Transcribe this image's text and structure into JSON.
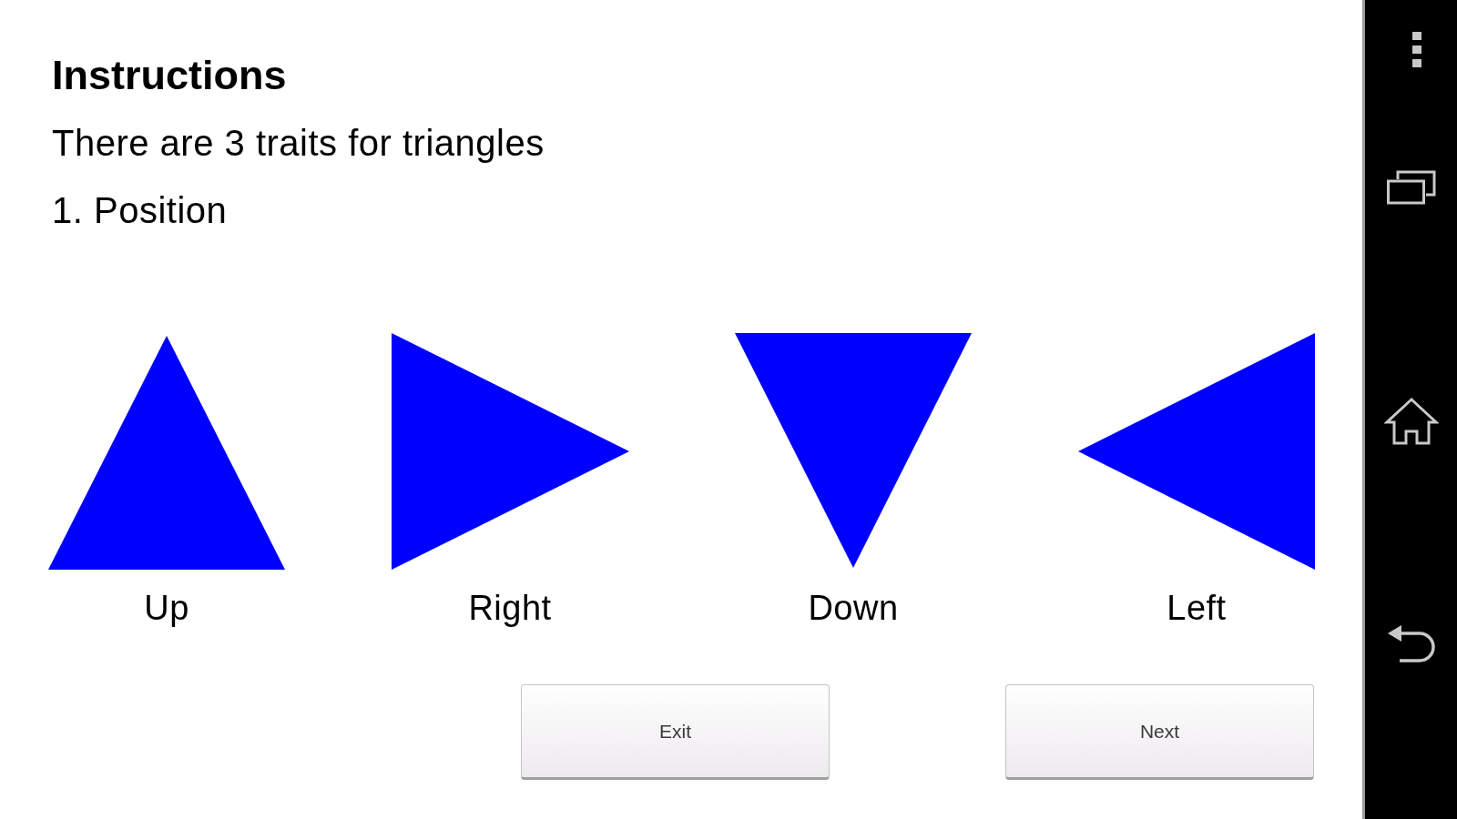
{
  "instructions": {
    "title": "Instructions",
    "intro": "There are 3 traits for triangles",
    "step": "1. Position"
  },
  "triangles": [
    {
      "kind": "up",
      "label": "Up"
    },
    {
      "kind": "right",
      "label": "Right"
    },
    {
      "kind": "down",
      "label": "Down"
    },
    {
      "kind": "left",
      "label": "Left"
    }
  ],
  "buttons": [
    {
      "label": "Exit"
    },
    {
      "label": "Next"
    }
  ]
}
